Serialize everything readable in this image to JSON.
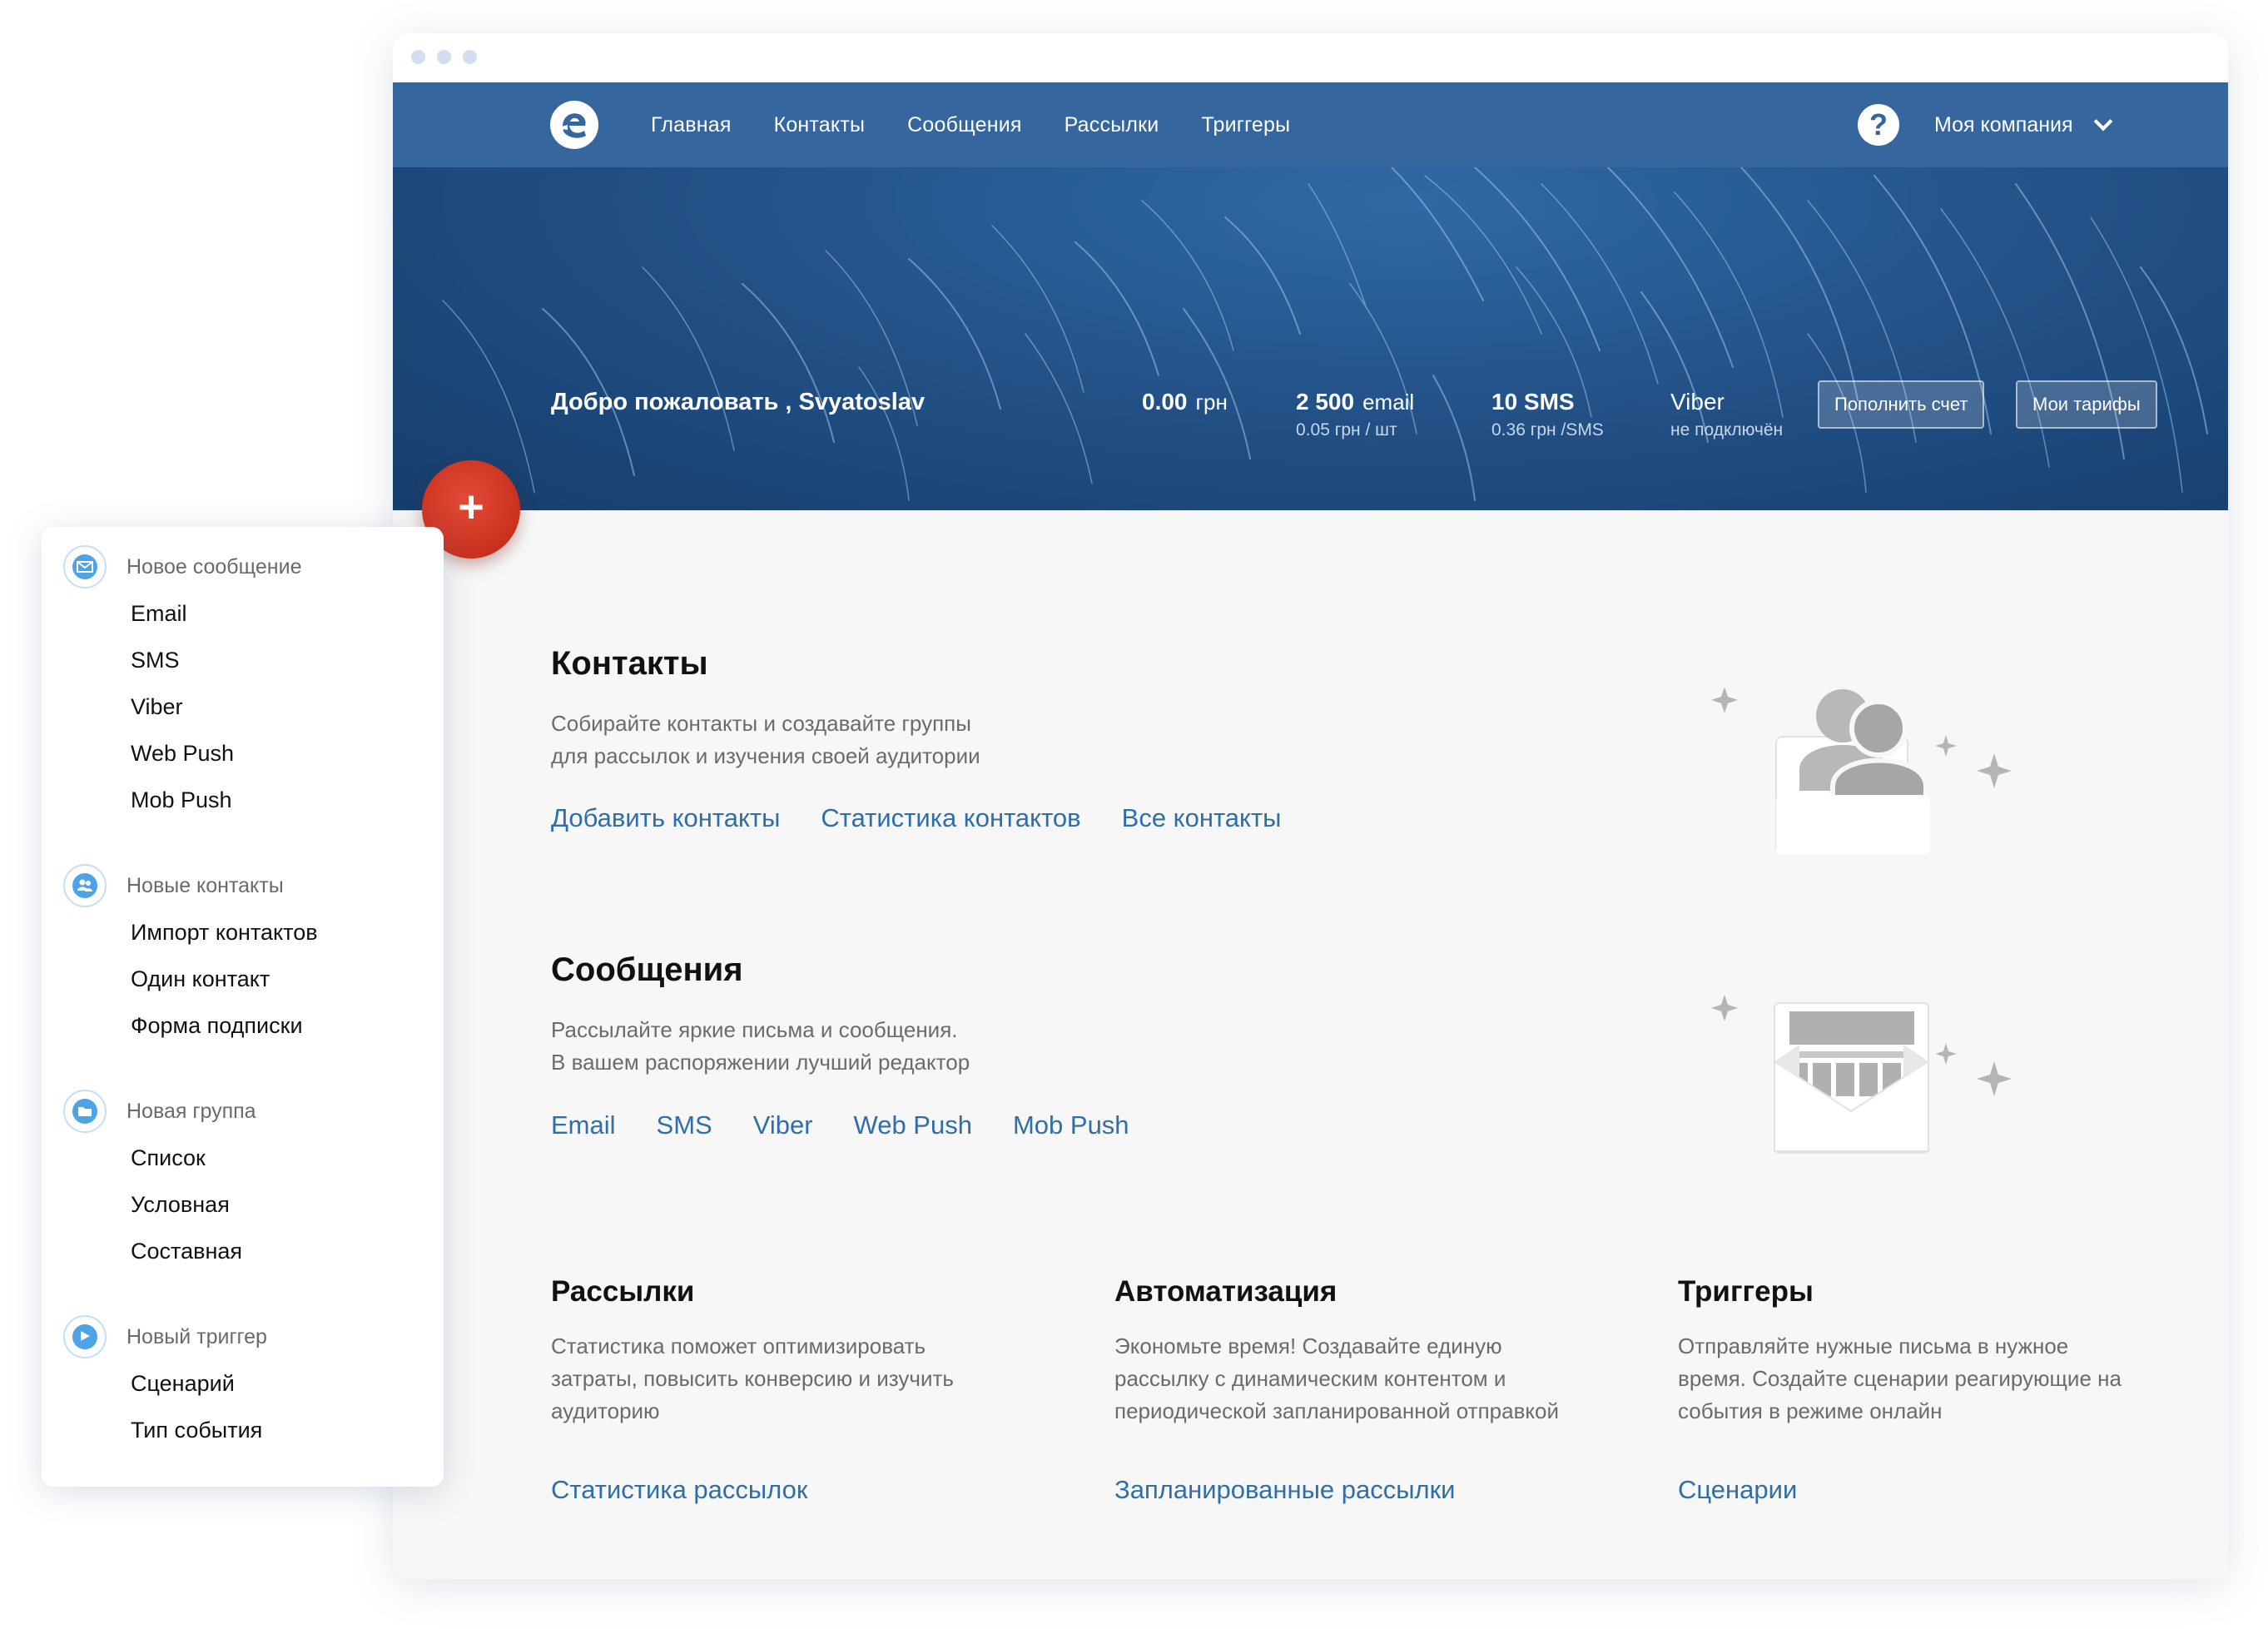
{
  "nav": {
    "links": [
      "Главная",
      "Контакты",
      "Сообщения",
      "Рассылки",
      "Триггеры"
    ],
    "help": "?",
    "company": "Моя компания"
  },
  "hero": {
    "welcome": "Добро пожаловать ,  Svyatoslav",
    "balance": {
      "value": "0.00",
      "unit": "грн"
    },
    "email": {
      "value": "2 500",
      "unit": "email",
      "sub": "0.05 грн / шт"
    },
    "sms": {
      "value": "10 SMS",
      "sub": "0.36  грн /SMS"
    },
    "viber": {
      "value": "Viber",
      "sub": "не подключён"
    },
    "btn_topup": "Пополнить счет",
    "btn_tariffs": "Мои тарифы"
  },
  "fab": "+",
  "contacts": {
    "title": "Контакты",
    "desc1": "Собирайте контакты и создавайте группы",
    "desc2": "для рассылок и изучения своей аудитории",
    "links": [
      "Добавить контакты",
      "Статистика контактов",
      "Все контакты"
    ]
  },
  "messages": {
    "title": "Сообщения",
    "desc1": "Рассылайте яркие письма и сообщения.",
    "desc2": "В вашем распоряжении лучший редактор",
    "links": [
      "Email",
      "SMS",
      "Viber",
      "Web Push",
      "Mob Push"
    ]
  },
  "cols": [
    {
      "title": "Рассылки",
      "desc": [
        "Статистика поможет оптимизировать",
        "затраты, повысить конверсию и изучить",
        "аудиторию"
      ],
      "link": "Статистика рассылок"
    },
    {
      "title": "Автоматизация",
      "desc": [
        "Экономьте время! Создавайте единую",
        "рассылку с динамическим контентом и",
        "периодической запланированной отправкой"
      ],
      "link": "Запланированные рассылки"
    },
    {
      "title": "Триггеры",
      "desc": [
        "Отправляйте нужные письма в нужное",
        "время. Создайте сценарии реагирующие на",
        "события в режиме онлайн"
      ],
      "link": "Сценарии"
    }
  ],
  "menu": {
    "groups": [
      {
        "icon": "envelope-icon",
        "label": "Новое сообщение",
        "items": [
          "Email",
          "SMS",
          "Viber",
          "Web Push",
          "Mob Push"
        ]
      },
      {
        "icon": "users-icon",
        "label": "Новые контакты",
        "items": [
          "Импорт контактов",
          "Один контакт",
          "Форма подписки"
        ]
      },
      {
        "icon": "folder-icon",
        "label": "Новая группа",
        "items": [
          "Список",
          "Условная",
          "Составная"
        ]
      },
      {
        "icon": "flag-icon",
        "label": "Новый триггер",
        "items": [
          "Сценарий",
          "Тип события"
        ]
      }
    ]
  },
  "colors": {
    "nav": "#35669d",
    "link": "#2f6ea8",
    "fab": "#d13a25",
    "menu_icon": "#4da3e6"
  }
}
